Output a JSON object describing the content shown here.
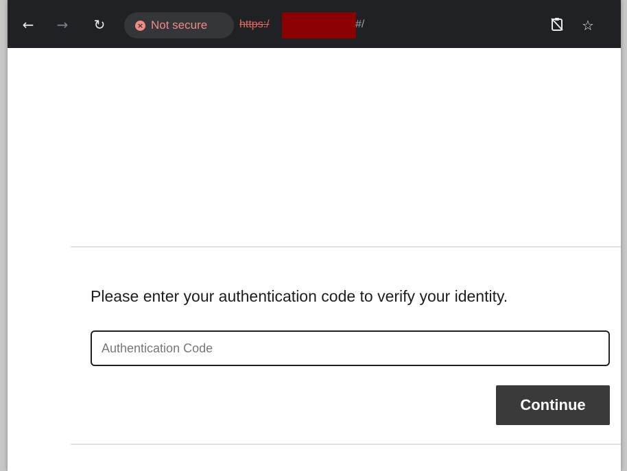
{
  "browser": {
    "security_label": "Not secure",
    "url_scheme": "https:/",
    "url_suffix": "#/",
    "icons": {
      "back": "back-arrow-icon",
      "forward": "forward-arrow-icon",
      "reload": "reload-icon",
      "insecure": "insecure-x-icon",
      "clipboard": "clipboard-off-icon",
      "bookmark": "star-icon"
    }
  },
  "auth": {
    "prompt": "Please enter your authentication code to verify your identity.",
    "code_placeholder": "Authentication Code",
    "code_value": "",
    "continue_label": "Continue"
  },
  "colors": {
    "toolbar_bg": "#202124",
    "insecure_red": "#f28b82",
    "redaction": "#8b0000",
    "button_bg": "#3a3a3a"
  }
}
